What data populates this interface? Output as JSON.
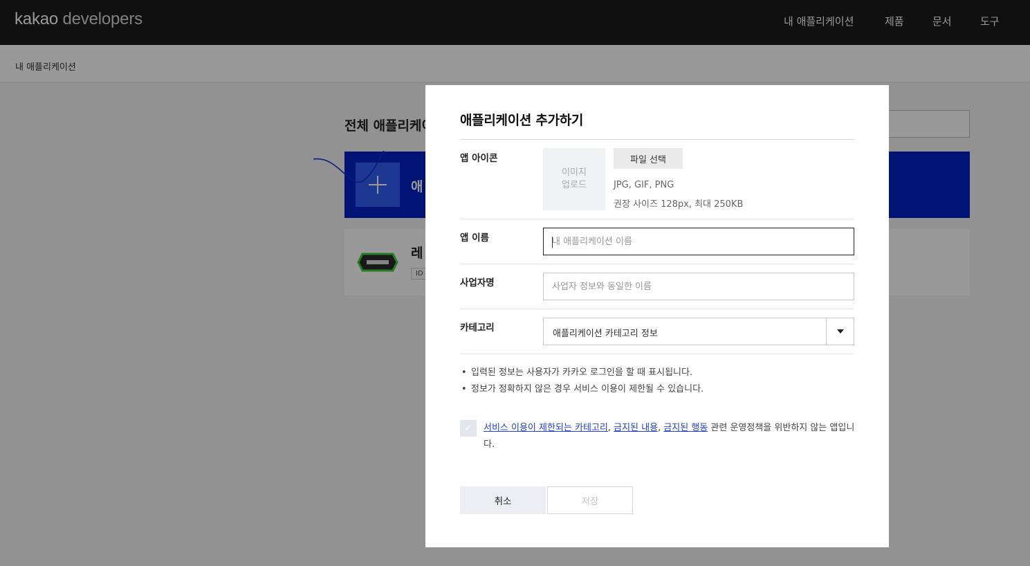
{
  "header": {
    "logo_bold": "kakao",
    "logo_light": "developers",
    "nav": [
      "내 애플리케이션",
      "제품",
      "문서",
      "도구"
    ]
  },
  "breadcrumb": "내 애플리케이션",
  "background": {
    "heading": "전체 애플리케이",
    "add_card_label": "애",
    "app_name": "레",
    "app_id": "ID"
  },
  "modal": {
    "title": "애플리케이션 추가하기",
    "icon_label": "앱 아이콘",
    "image_upload_line1": "이미지",
    "image_upload_line2": "업로드",
    "file_button": "파일 선택",
    "file_formats": "JPG, GIF, PNG",
    "file_size": "권장 사이즈 128px, 최대 250KB",
    "app_name_label": "앱 이름",
    "app_name_placeholder": "내 애플리케이션 이름",
    "company_label": "사업자명",
    "company_placeholder": "사업자 정보와 동일한 이름",
    "category_label": "카테고리",
    "category_value": "애플리케이션 카테고리 정보",
    "notices": [
      "입력된 정보는 사용자가 카카오 로그인을 할 때 표시됩니다.",
      "정보가 정확하지 않은 경우 서비스 이용이 제한될 수 있습니다."
    ],
    "agree": {
      "link1": "서비스 이용이 제한되는 카테고리",
      "link2": "금지된 내용",
      "link3": "금지된 행동",
      "sep": ",",
      "rest": " 관련 운영정책을 위반하지 않는 앱입니다."
    },
    "cancel_button": "취소",
    "save_button": "저장"
  },
  "colors": {
    "header_bg": "#1b1b1b",
    "accent_blue": "#0022c4",
    "link_blue": "#2341d1"
  }
}
